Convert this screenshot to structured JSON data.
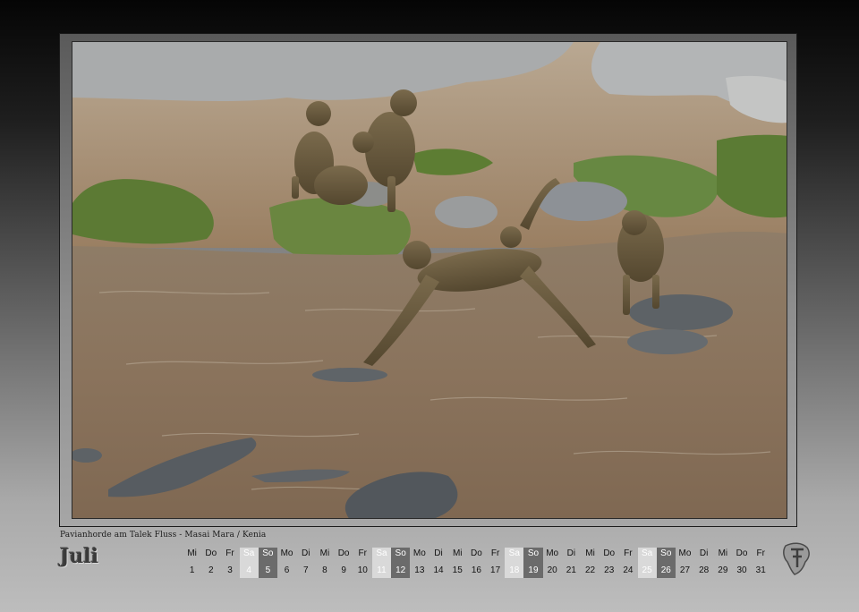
{
  "caption": "Pavianhorde am Talek Fluss - Masai Mara / Kenia",
  "month": "Juli",
  "days": [
    {
      "wd": "Mi",
      "d": "1",
      "type": "normal"
    },
    {
      "wd": "Do",
      "d": "2",
      "type": "normal"
    },
    {
      "wd": "Fr",
      "d": "3",
      "type": "normal"
    },
    {
      "wd": "Sa",
      "d": "4",
      "type": "sa"
    },
    {
      "wd": "So",
      "d": "5",
      "type": "so"
    },
    {
      "wd": "Mo",
      "d": "6",
      "type": "normal"
    },
    {
      "wd": "Di",
      "d": "7",
      "type": "normal"
    },
    {
      "wd": "Mi",
      "d": "8",
      "type": "normal"
    },
    {
      "wd": "Do",
      "d": "9",
      "type": "normal"
    },
    {
      "wd": "Fr",
      "d": "10",
      "type": "normal"
    },
    {
      "wd": "Sa",
      "d": "11",
      "type": "sa"
    },
    {
      "wd": "So",
      "d": "12",
      "type": "so"
    },
    {
      "wd": "Mo",
      "d": "13",
      "type": "normal"
    },
    {
      "wd": "Di",
      "d": "14",
      "type": "normal"
    },
    {
      "wd": "Mi",
      "d": "15",
      "type": "normal"
    },
    {
      "wd": "Do",
      "d": "16",
      "type": "normal"
    },
    {
      "wd": "Fr",
      "d": "17",
      "type": "normal"
    },
    {
      "wd": "Sa",
      "d": "18",
      "type": "sa"
    },
    {
      "wd": "So",
      "d": "19",
      "type": "so"
    },
    {
      "wd": "Mo",
      "d": "20",
      "type": "normal"
    },
    {
      "wd": "Di",
      "d": "21",
      "type": "normal"
    },
    {
      "wd": "Mi",
      "d": "22",
      "type": "normal"
    },
    {
      "wd": "Do",
      "d": "23",
      "type": "normal"
    },
    {
      "wd": "Fr",
      "d": "24",
      "type": "normal"
    },
    {
      "wd": "Sa",
      "d": "25",
      "type": "sa"
    },
    {
      "wd": "So",
      "d": "26",
      "type": "so"
    },
    {
      "wd": "Mo",
      "d": "27",
      "type": "normal"
    },
    {
      "wd": "Di",
      "d": "28",
      "type": "normal"
    },
    {
      "wd": "Mi",
      "d": "29",
      "type": "normal"
    },
    {
      "wd": "Do",
      "d": "30",
      "type": "normal"
    },
    {
      "wd": "Fr",
      "d": "31",
      "type": "normal"
    }
  ],
  "colors": {
    "saturday_bg": "#d9d9d9",
    "sunday_bg": "#6b6b6b",
    "river": "#8a7560",
    "bank": "#a48b6f"
  },
  "icons": {
    "logo": "africa-monogram-logo"
  }
}
